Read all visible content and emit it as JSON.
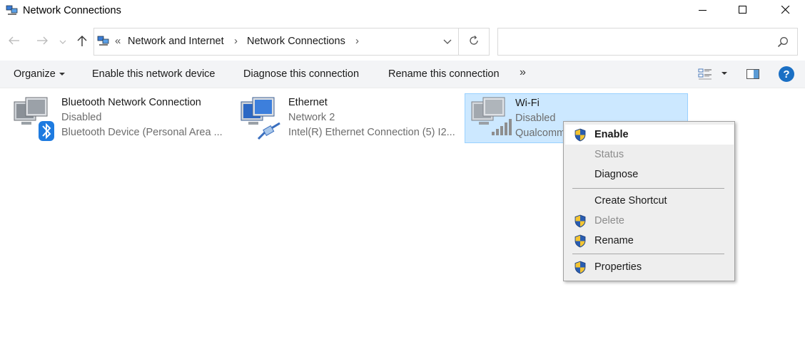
{
  "window": {
    "title": "Network Connections"
  },
  "address": {
    "overflow_chevron": "«",
    "breadcrumbs": [
      "Network and Internet",
      "Network Connections"
    ],
    "separator": "›",
    "search_placeholder": ""
  },
  "toolbar": {
    "organize": "Organize",
    "enable": "Enable this network device",
    "diagnose": "Diagnose this connection",
    "rename": "Rename this connection",
    "more": "»"
  },
  "items": [
    {
      "name": "Bluetooth Network Connection",
      "status": "Disabled",
      "device": "Bluetooth Device (Personal Area ...",
      "icon": "bluetooth-network-icon"
    },
    {
      "name": "Ethernet",
      "status": "Network 2",
      "device": "Intel(R) Ethernet Connection (5) I2...",
      "icon": "ethernet-network-icon"
    },
    {
      "name": "Wi-Fi",
      "status": "Disabled",
      "device": "Qualcomm",
      "icon": "wifi-network-icon",
      "selected": true
    }
  ],
  "context_menu": {
    "items": [
      {
        "label": "Enable",
        "shield": true,
        "bold": true,
        "disabled": false,
        "hover": true
      },
      {
        "label": "Status",
        "shield": false,
        "bold": false,
        "disabled": true
      },
      {
        "label": "Diagnose",
        "shield": false,
        "bold": false,
        "disabled": false
      },
      {
        "label": "Create Shortcut",
        "shield": false,
        "bold": false,
        "disabled": false
      },
      {
        "label": "Delete",
        "shield": true,
        "bold": false,
        "disabled": true
      },
      {
        "label": "Rename",
        "shield": true,
        "bold": false,
        "disabled": false
      },
      {
        "label": "Properties",
        "shield": true,
        "bold": false,
        "disabled": false
      }
    ]
  },
  "colors": {
    "selection_bg": "#cce8ff",
    "selection_border": "#99d1ff",
    "command_bar_bg": "#f3f4f6",
    "menu_bg": "#eeeeee",
    "help_blue": "#1a6fc4",
    "shield_blue": "#2a5db0",
    "shield_yellow": "#f4c430"
  },
  "icons": {
    "title": "network-connections-icon",
    "back": "back-arrow-icon",
    "forward": "forward-arrow-icon",
    "recent": "chevron-down-icon",
    "up": "up-arrow-icon",
    "refresh": "refresh-icon",
    "search": "search-icon",
    "minimize": "minimize-icon",
    "maximize": "maximize-icon",
    "close": "close-icon",
    "help": "help-icon",
    "uac_shield": "uac-shield-icon"
  }
}
